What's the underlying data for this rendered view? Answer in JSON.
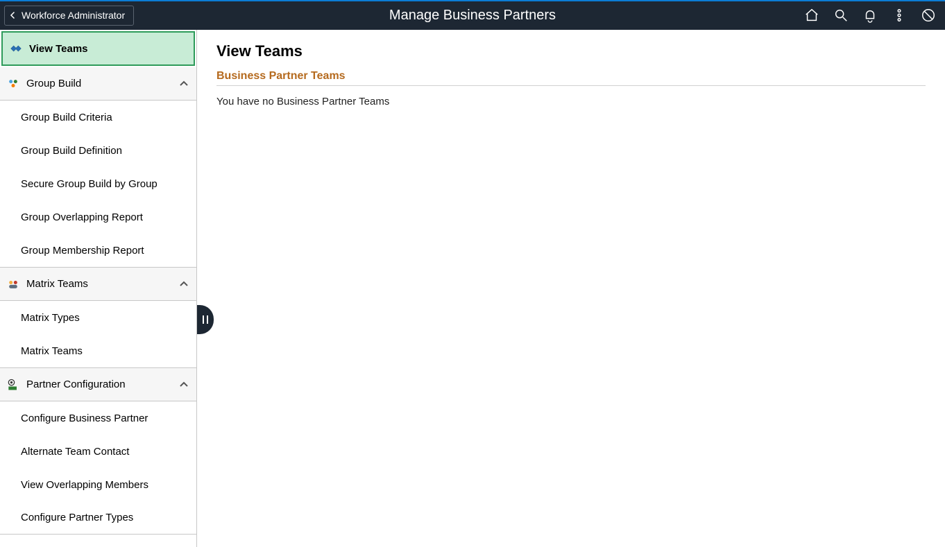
{
  "header": {
    "back_label": "Workforce Administrator",
    "title": "Manage Business Partners"
  },
  "sidebar": {
    "selected_label": "View Teams",
    "groups": [
      {
        "label": "Group Build",
        "items": [
          {
            "label": "Group Build Criteria"
          },
          {
            "label": "Group Build Definition"
          },
          {
            "label": "Secure Group Build by Group"
          },
          {
            "label": "Group Overlapping Report"
          },
          {
            "label": "Group Membership Report"
          }
        ]
      },
      {
        "label": "Matrix Teams",
        "items": [
          {
            "label": "Matrix Types"
          },
          {
            "label": "Matrix Teams"
          }
        ]
      },
      {
        "label": "Partner Configuration",
        "items": [
          {
            "label": "Configure Business Partner"
          },
          {
            "label": "Alternate Team Contact"
          },
          {
            "label": "View Overlapping Members"
          },
          {
            "label": "Configure Partner Types"
          }
        ]
      }
    ]
  },
  "main": {
    "page_title": "View Teams",
    "section_title": "Business Partner Teams",
    "empty_message": "You have no Business Partner Teams"
  }
}
